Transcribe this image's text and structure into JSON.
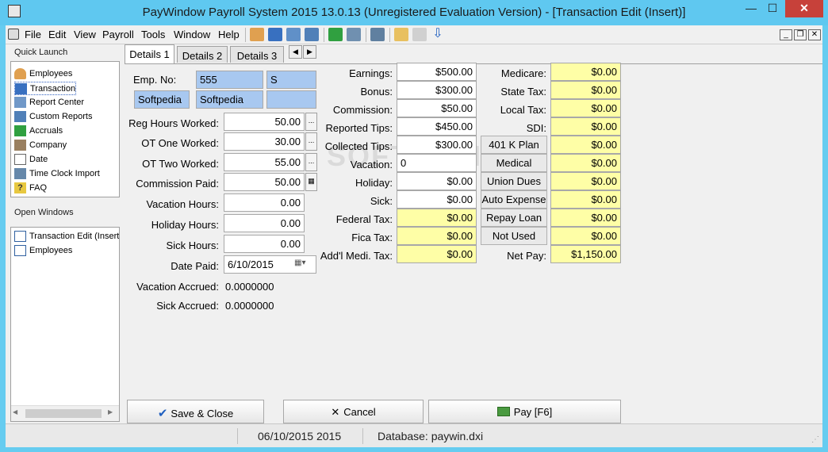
{
  "window": {
    "title": "PayWindow Payroll System 2015  13.0.13 (Unregistered Evaluation Version) - [Transaction Edit (Insert)]",
    "close": "✕",
    "minimize": "—",
    "maximize": "☐"
  },
  "menu": [
    "File",
    "Edit",
    "View",
    "Payroll",
    "Tools",
    "Window",
    "Help"
  ],
  "sidebar": {
    "quick_launch_label": "Quick Launch",
    "quick_items": [
      {
        "label": "Employees",
        "icon": "employees-icon"
      },
      {
        "label": "Transaction",
        "icon": "transaction-icon"
      },
      {
        "label": "Report Center",
        "icon": "report-center-icon"
      },
      {
        "label": "Custom Reports",
        "icon": "custom-reports-icon"
      },
      {
        "label": "Accruals",
        "icon": "accruals-icon"
      },
      {
        "label": "Company",
        "icon": "company-icon"
      },
      {
        "label": "Date",
        "icon": "date-icon"
      },
      {
        "label": "Time Clock Import",
        "icon": "time-clock-icon"
      },
      {
        "label": "FAQ",
        "icon": "faq-icon"
      }
    ],
    "open_windows_label": "Open Windows",
    "open_windows": [
      "Transaction Edit (Insert)",
      "Employees"
    ]
  },
  "tabs": [
    "Details 1",
    "Details 2",
    "Details 3"
  ],
  "form": {
    "emp_no_label": "Emp. No:",
    "emp_no": "555",
    "emp_code": "S",
    "company1": "Softpedia",
    "company2": "Softpedia",
    "company3": "",
    "rows": [
      {
        "label": "Reg Hours Worked:",
        "value": "50.00",
        "btn": "..."
      },
      {
        "label": "OT One Worked:",
        "value": "30.00",
        "btn": "..."
      },
      {
        "label": "OT Two Worked:",
        "value": "55.00",
        "btn": "..."
      },
      {
        "label": "Commission Paid:",
        "value": "50.00",
        "btn": "▦"
      },
      {
        "label": "Vacation Hours:",
        "value": "0.00",
        "btn": ""
      },
      {
        "label": "Holiday Hours:",
        "value": "0.00",
        "btn": ""
      },
      {
        "label": "Sick Hours:",
        "value": "0.00",
        "btn": ""
      }
    ],
    "date_paid_label": "Date Paid:",
    "date_paid": "6/10/2015",
    "vacation_accrued_label": "Vacation Accrued:",
    "vacation_accrued": "0.0000000",
    "sick_accrued_label": "Sick Accrued:",
    "sick_accrued": "0.0000000"
  },
  "earnings": [
    {
      "label": "Earnings:",
      "value": "$500.00",
      "yellow": false
    },
    {
      "label": "Bonus:",
      "value": "$300.00",
      "yellow": false
    },
    {
      "label": "Commission:",
      "value": "$50.00",
      "yellow": false
    },
    {
      "label": "Reported Tips:",
      "value": "$450.00",
      "yellow": false
    },
    {
      "label": "Collected Tips:",
      "value": "$300.00",
      "yellow": false
    },
    {
      "label": "Vacation:",
      "value": "0",
      "yellow": false
    },
    {
      "label": "Holiday:",
      "value": "$0.00",
      "yellow": false
    },
    {
      "label": "Sick:",
      "value": "$0.00",
      "yellow": false
    },
    {
      "label": "Federal Tax:",
      "value": "$0.00",
      "yellow": true
    },
    {
      "label": "Fica Tax:",
      "value": "$0.00",
      "yellow": true
    },
    {
      "label": "Add'l Medi. Tax:",
      "value": "$0.00",
      "yellow": true
    }
  ],
  "deductions": [
    {
      "label": "Medicare:",
      "value": "$0.00",
      "button": false
    },
    {
      "label": "State Tax:",
      "value": "$0.00",
      "button": false
    },
    {
      "label": "Local Tax:",
      "value": "$0.00",
      "button": false
    },
    {
      "label": "SDI:",
      "value": "$0.00",
      "button": false
    },
    {
      "label": "401 K Plan",
      "value": "$0.00",
      "button": true
    },
    {
      "label": "Medical",
      "value": "$0.00",
      "button": true
    },
    {
      "label": "Union Dues",
      "value": "$0.00",
      "button": true
    },
    {
      "label": "Auto Expense",
      "value": "$0.00",
      "button": true
    },
    {
      "label": "Repay Loan",
      "value": "$0.00",
      "button": true
    },
    {
      "label": "Not Used",
      "value": "$0.00",
      "button": true
    },
    {
      "label": "Net Pay:",
      "value": "$1,150.00",
      "button": false
    }
  ],
  "buttons": {
    "save": "Save & Close",
    "cancel": "Cancel",
    "pay": "Pay [F6]"
  },
  "status": {
    "date": "06/10/2015 2015",
    "database": "Database: paywin.dxi"
  },
  "watermark": "SOFTPEDIA",
  "colors": {
    "titlebar": "#5fc8f0",
    "close": "#c7413a",
    "yellow": "#fefea6",
    "blue": "#a8c8f0"
  }
}
